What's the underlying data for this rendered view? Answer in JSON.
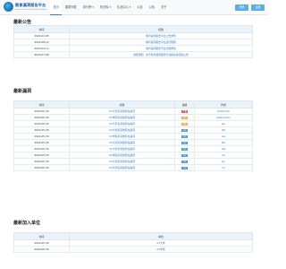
{
  "brand": {
    "title": "教育漏洞报告平台",
    "subtitle": "Education Vulnerability Report Platform"
  },
  "nav": [
    {
      "label": "首页",
      "active": true
    },
    {
      "label": "漏洞列表",
      "active": false
    },
    {
      "label": "排行榜 ▾",
      "active": false
    },
    {
      "label": "知识库 ▾",
      "active": false
    },
    {
      "label": "礼品中心 ▾",
      "active": false
    },
    {
      "label": "公告",
      "active": false
    },
    {
      "label": "公告",
      "active": false
    },
    {
      "label": "关于",
      "active": false
    }
  ],
  "buttons": {
    "login": "登录",
    "register": "注册"
  },
  "announcements": {
    "title": "最新公告",
    "columns": [
      "时间",
      "标题"
    ],
    "rows": [
      {
        "date": "2024-02-05",
        "title": "教育漏洞报告平台公告通知"
      },
      {
        "date": "2022-08-12",
        "title": "教育漏洞报告平台运行规则"
      },
      {
        "date": "2024-04-12",
        "title": "教育漏洞报告平台合规通知"
      },
      {
        "date": "2023-07-06",
        "title": "重要通知：关于教育漏洞报告平台相关事宜的公告"
      }
    ]
  },
  "vulns": {
    "title": "最新漏洞",
    "columns": [
      "时间",
      "标题",
      "等级",
      "作者"
    ],
    "rows": [
      {
        "date": "2024-05-30",
        "title": "XX大学某系统存在漏洞",
        "level": "严重",
        "color": "#e0483a",
        "author": "HACK-Cdb"
      },
      {
        "date": "2024-05-30",
        "title": "XX学院某系统存在漏洞",
        "level": "中危",
        "color": "#f0a23a",
        "author": "apple-Ledu"
      },
      {
        "date": "2024-05-30",
        "title": "XX大学某系统存在漏洞",
        "level": "中危",
        "color": "#f0a23a",
        "author": "zjp"
      },
      {
        "date": "2024-05-30",
        "title": "XX大学某系统存在漏洞",
        "level": "中危",
        "color": "#3c8fd6",
        "author": "Atk"
      },
      {
        "date": "2024-05-30",
        "title": "XX学院某系统存在漏洞",
        "level": "中危",
        "color": "#3c8fd6",
        "author": "xxx"
      },
      {
        "date": "2024-05-30",
        "title": "XX大学某系统存在漏洞",
        "level": "中危",
        "color": "#3c8fd6",
        "author": "Ba"
      },
      {
        "date": "2024-05-30",
        "title": "XX大学某系统存在漏洞",
        "level": "中危",
        "color": "#3c8fd6",
        "author": "GQ"
      },
      {
        "date": "2024-05-30",
        "title": "XX学院某系统存在漏洞",
        "level": "中危",
        "color": "#3c8fd6",
        "author": "ali"
      },
      {
        "date": "2024-05-30",
        "title": "XX大学某系统存在漏洞",
        "level": "中危",
        "color": "#3c8fd6",
        "author": "zjy"
      },
      {
        "date": "2024-05-30",
        "title": "XX大学某系统存在漏洞",
        "level": "中危",
        "color": "#3c8fd6",
        "author": "Ql"
      }
    ]
  },
  "units": {
    "title": "最新加入单位",
    "columns": [
      "时间",
      "单位"
    ],
    "rows": [
      {
        "date": "2024-05-30",
        "unit": "XX大学"
      },
      {
        "date": "2024-05-30",
        "unit": "XX学院"
      }
    ]
  }
}
